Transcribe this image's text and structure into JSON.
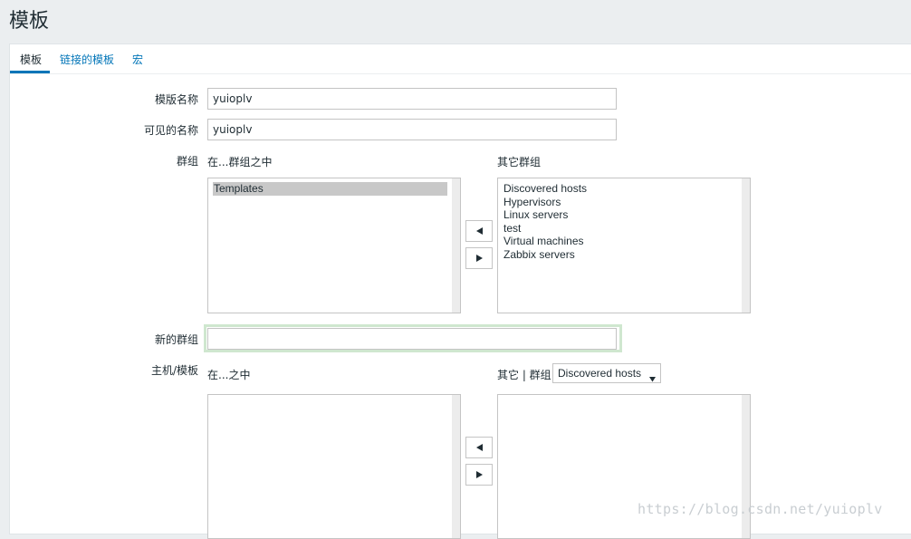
{
  "page": {
    "title": "模板"
  },
  "tabs": [
    {
      "label": "模板",
      "active": true
    },
    {
      "label": "链接的模板",
      "active": false
    },
    {
      "label": "宏",
      "active": false
    }
  ],
  "form": {
    "template_name": {
      "label": "模版名称",
      "value": "yuioplv"
    },
    "visible_name": {
      "label": "可见的名称",
      "value": "yuioplv"
    },
    "groups": {
      "label": "群组",
      "in_groups_label": "在...群组之中",
      "other_groups_label": "其它群组",
      "in_groups": [
        "Templates"
      ],
      "other_groups": [
        "Discovered hosts",
        "Hypervisors",
        "Linux servers",
        "test",
        "Virtual machines",
        "Zabbix servers"
      ],
      "move_left_icon": "triangle-left-icon",
      "move_right_icon": "triangle-right-icon"
    },
    "new_group": {
      "label": "新的群组",
      "value": ""
    },
    "hosts_templates": {
      "label": "主机/模板",
      "in_label": "在...之中",
      "other_label": "其它 | 群组",
      "group_select": "Discovered hosts",
      "in_items": [],
      "other_items": []
    }
  },
  "watermark": "https://blog.csdn.net/yuioplv"
}
